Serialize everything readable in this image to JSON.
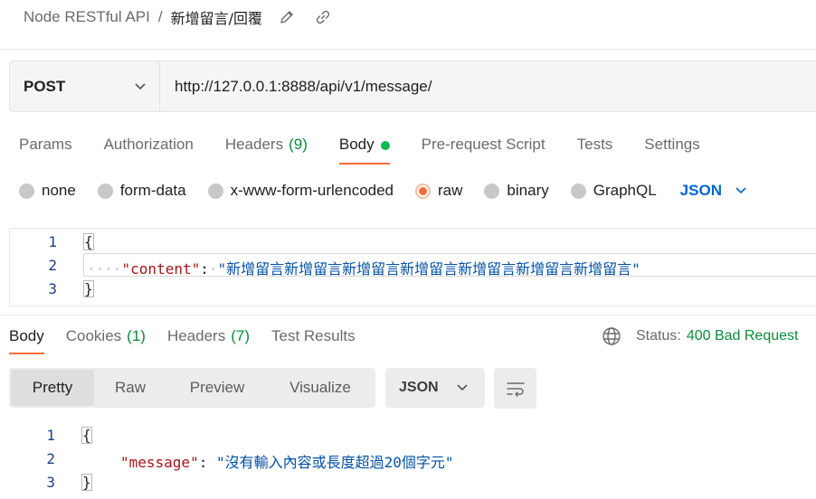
{
  "breadcrumb": {
    "collection": "Node RESTful API",
    "separator": "/",
    "request_name": "新增留言/回覆",
    "edit_icon": "pencil-icon",
    "link_icon": "link-icon"
  },
  "request": {
    "method": "POST",
    "url": "http://127.0.0.1:8888/api/v1/message/"
  },
  "request_tabs": [
    {
      "label": "Params"
    },
    {
      "label": "Authorization"
    },
    {
      "label": "Headers",
      "count": "(9)"
    },
    {
      "label": "Body",
      "active": true
    },
    {
      "label": "Pre-request Script"
    },
    {
      "label": "Tests"
    },
    {
      "label": "Settings"
    }
  ],
  "body_types": [
    {
      "label": "none"
    },
    {
      "label": "form-data"
    },
    {
      "label": "x-www-form-urlencoded"
    },
    {
      "label": "raw",
      "selected": true
    },
    {
      "label": "binary"
    },
    {
      "label": "GraphQL"
    }
  ],
  "body_format": "JSON",
  "request_body": {
    "line_numbers": [
      "1",
      "2",
      "3"
    ],
    "open_brace": "{",
    "indent": "····",
    "key": "\"content\"",
    "colon": ":",
    "dot": "·",
    "value": "\"新增留言新增留言新增留言新增留言新增留言新增留言新增留言\"",
    "close_brace": "}"
  },
  "response_tabs": [
    {
      "label": "Body",
      "active": true
    },
    {
      "label": "Cookies",
      "count": "(1)"
    },
    {
      "label": "Headers",
      "count": "(7)"
    },
    {
      "label": "Test Results"
    }
  ],
  "status": {
    "label": "Status:",
    "value": "400 Bad Request"
  },
  "view_modes": [
    "Pretty",
    "Raw",
    "Preview",
    "Visualize"
  ],
  "response_format": "JSON",
  "response_body": {
    "line_numbers": [
      "1",
      "2",
      "3"
    ],
    "open_brace": "{",
    "key": "\"message\"",
    "colon": ":",
    "value": "\"沒有輸入內容或長度超過20個字元\"",
    "close_brace": "}"
  },
  "colors": {
    "accent": "#ff6c37",
    "success": "#0c8b3c",
    "link": "#0265d2"
  }
}
